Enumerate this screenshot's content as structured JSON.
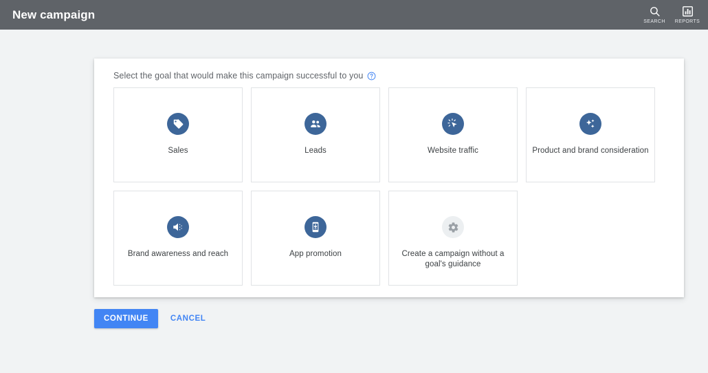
{
  "header": {
    "title": "New campaign",
    "background_color": "#5f6368",
    "actions": [
      {
        "icon": "search-icon",
        "label": "SEARCH"
      },
      {
        "icon": "reports-icon",
        "label": "REPORTS"
      }
    ]
  },
  "panel": {
    "prompt": "Select the goal that would make this campaign successful to you",
    "help_icon": "help-circle-icon",
    "help_icon_color": "#4285f4"
  },
  "goals": [
    {
      "label": "Sales",
      "icon": "price-tag-icon",
      "icon_style": "filled",
      "icon_bg": "#3d6699"
    },
    {
      "label": "Leads",
      "icon": "people-icon",
      "icon_style": "filled",
      "icon_bg": "#3d6699"
    },
    {
      "label": "Website traffic",
      "icon": "click-cursor-icon",
      "icon_style": "filled",
      "icon_bg": "#3d6699"
    },
    {
      "label": "Product and brand consideration",
      "icon": "sparkles-icon",
      "icon_style": "filled",
      "icon_bg": "#3d6699"
    },
    {
      "label": "Brand awareness and reach",
      "icon": "megaphone-icon",
      "icon_style": "filled",
      "icon_bg": "#3d6699"
    },
    {
      "label": "App promotion",
      "icon": "mobile-download-icon",
      "icon_style": "filled",
      "icon_bg": "#3d6699"
    },
    {
      "label": "Create a campaign without a goal's guidance",
      "icon": "gear-icon",
      "icon_style": "muted",
      "icon_bg": "#eceff1"
    }
  ],
  "footer": {
    "continue_label": "CONTINUE",
    "cancel_label": "CANCEL",
    "primary_color": "#4285f4"
  }
}
